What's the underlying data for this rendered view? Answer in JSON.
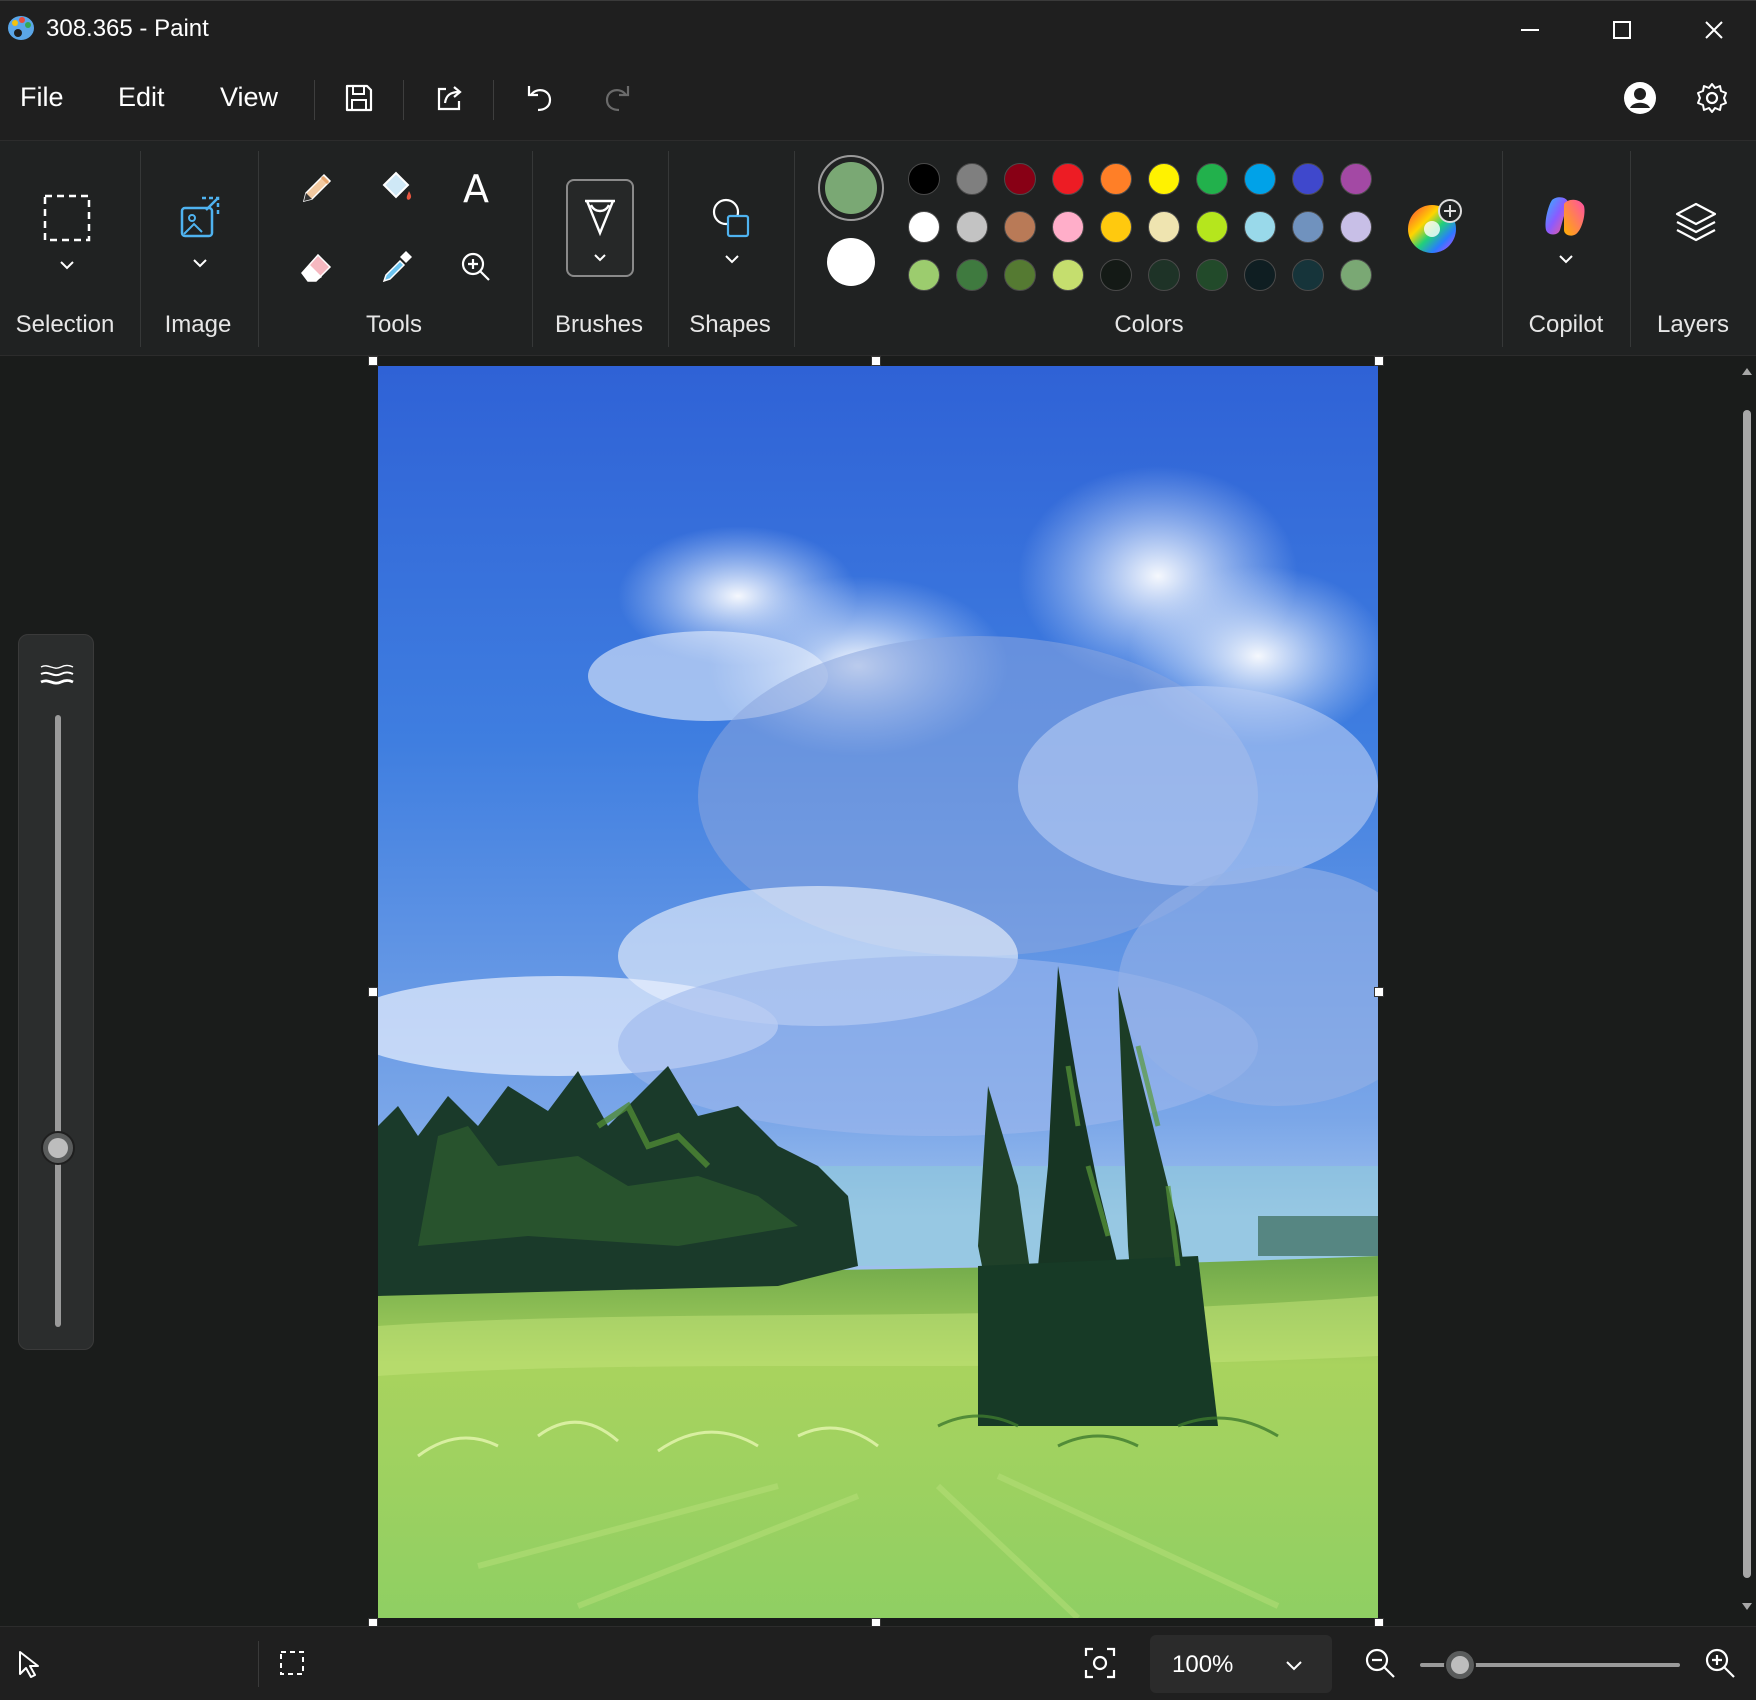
{
  "window": {
    "title": "308.365 - Paint"
  },
  "menu": {
    "file": "File",
    "edit": "Edit",
    "view": "View"
  },
  "ribbon": {
    "groups": {
      "selection": "Selection",
      "image": "Image",
      "tools": "Tools",
      "brushes": "Brushes",
      "shapes": "Shapes",
      "colors": "Colors",
      "copilot": "Copilot",
      "layers": "Layers"
    },
    "text_tool_glyph": "A",
    "primary_color": "#7aa874",
    "secondary_color": "#ffffff",
    "palette": [
      [
        "#000000",
        "#7f7f7f",
        "#880015",
        "#ed1c24",
        "#ff7f27",
        "#fff200",
        "#22b14c",
        "#00a2e8",
        "#3f48cc",
        "#a349a4"
      ],
      [
        "#ffffff",
        "#c3c3c3",
        "#b97a57",
        "#ffaec9",
        "#ffc90e",
        "#efe4b0",
        "#b5e61d",
        "#99d9ea",
        "#7092be",
        "#c8bfe7"
      ],
      [
        "#9ccc6e",
        "#3f7a3f",
        "#557a32",
        "#c5de6e",
        "#141a16",
        "#1e3327",
        "#224a2a",
        "#0f1e22",
        "#16343a",
        "#7aa874"
      ]
    ]
  },
  "status": {
    "zoom": "100%"
  },
  "icons": {
    "app": "paint-palette-icon",
    "minimize": "minimize-icon",
    "maximize": "maximize-icon",
    "close": "close-icon",
    "save": "save-icon",
    "share": "share-icon",
    "undo": "undo-icon",
    "redo": "redo-icon",
    "account": "account-icon",
    "settings": "gear-icon"
  }
}
